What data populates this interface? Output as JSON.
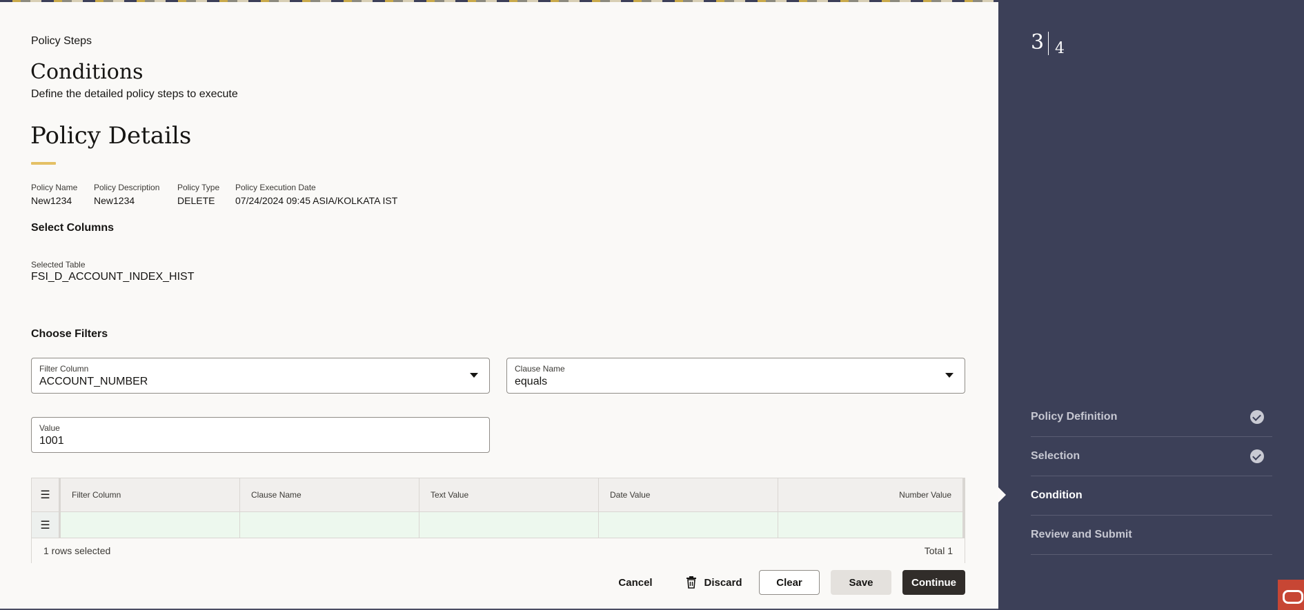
{
  "header": {
    "eyebrow": "Policy Steps",
    "title": "Conditions",
    "subtitle": "Define the detailed policy steps to execute"
  },
  "policy_details": {
    "title": "Policy Details",
    "fields": [
      {
        "label": "Policy Name",
        "value": "New1234"
      },
      {
        "label": "Policy Description",
        "value": "New1234"
      },
      {
        "label": "Policy Type",
        "value": "DELETE"
      },
      {
        "label": "Policy Execution Date",
        "value": "07/24/2024 09:45 ASIA/KOLKATA IST"
      }
    ]
  },
  "select_columns": {
    "title": "Select Columns",
    "selected_table_label": "Selected Table",
    "selected_table_value": "FSI_D_ACCOUNT_INDEX_HIST"
  },
  "filters": {
    "title": "Choose Filters",
    "filter_column": {
      "label": "Filter Column",
      "value": "ACCOUNT_NUMBER"
    },
    "clause_name": {
      "label": "Clause Name",
      "value": "equals"
    },
    "value": {
      "label": "Value",
      "value": "1001"
    }
  },
  "grid": {
    "columns": [
      "Filter Column",
      "Clause Name",
      "Text Value",
      "Date Value",
      "Number Value"
    ],
    "rows": [
      [
        "",
        "",
        "",
        "",
        ""
      ]
    ],
    "selected_text": "1 rows selected",
    "total_text": "Total 1",
    "menu_glyph": "☰"
  },
  "actions": {
    "cancel": "Cancel",
    "discard": "Discard",
    "clear": "Clear",
    "save": "Save",
    "continue": "Continue"
  },
  "train": {
    "current": "3",
    "total": "4",
    "steps": [
      {
        "label": "Policy Definition",
        "status": "complete"
      },
      {
        "label": "Selection",
        "status": "complete"
      },
      {
        "label": "Condition",
        "status": "current"
      },
      {
        "label": "Review and Submit",
        "status": "pending"
      }
    ]
  },
  "colors": {
    "sidebar": "#3c4058",
    "accent": "#e4c065",
    "primary_button": "#312d2a",
    "row_selected": "#edf8ee",
    "brand": "#c74634"
  },
  "icons": {
    "discard": "trash-icon",
    "complete": "check-circle-icon",
    "dropdown": "chevron-down-icon",
    "brand": "oracle-logo"
  }
}
